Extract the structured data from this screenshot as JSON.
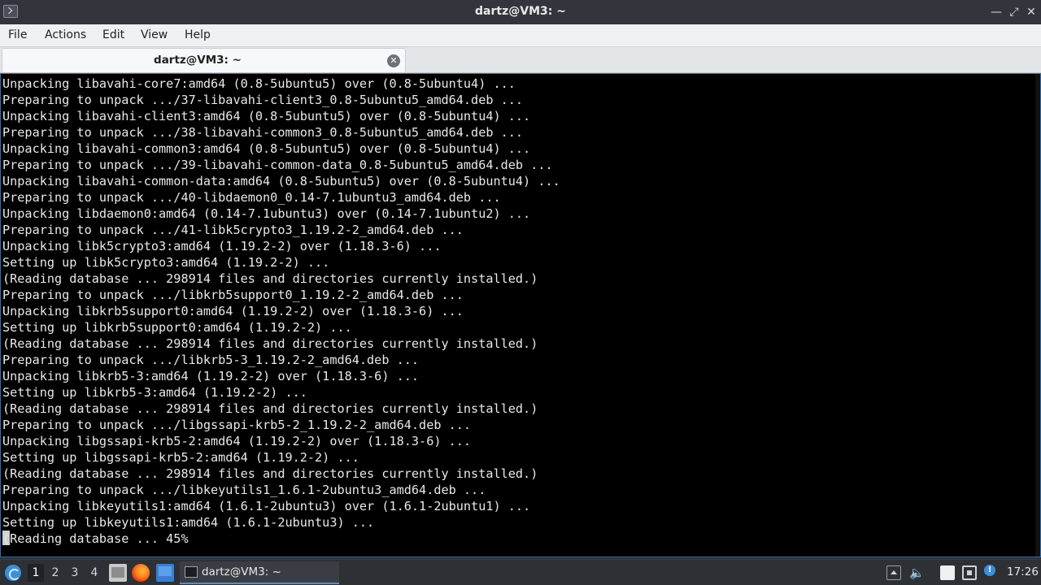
{
  "window": {
    "title": "dartz@VM3: ~",
    "icons": {
      "app": "terminal-icon",
      "minimize": "minimize-icon",
      "maximize": "maximize-icon",
      "close": "close-icon"
    }
  },
  "menu": {
    "file": "File",
    "actions": "Actions",
    "edit": "Edit",
    "view": "View",
    "help": "Help"
  },
  "tab": {
    "label": "dartz@VM3: ~",
    "close_icon": "close-circle-icon"
  },
  "terminal": {
    "lines": [
      "Unpacking libavahi-core7:amd64 (0.8-5ubuntu5) over (0.8-5ubuntu4) ...",
      "Preparing to unpack .../37-libavahi-client3_0.8-5ubuntu5_amd64.deb ...",
      "Unpacking libavahi-client3:amd64 (0.8-5ubuntu5) over (0.8-5ubuntu4) ...",
      "Preparing to unpack .../38-libavahi-common3_0.8-5ubuntu5_amd64.deb ...",
      "Unpacking libavahi-common3:amd64 (0.8-5ubuntu5) over (0.8-5ubuntu4) ...",
      "Preparing to unpack .../39-libavahi-common-data_0.8-5ubuntu5_amd64.deb ...",
      "Unpacking libavahi-common-data:amd64 (0.8-5ubuntu5) over (0.8-5ubuntu4) ...",
      "Preparing to unpack .../40-libdaemon0_0.14-7.1ubuntu3_amd64.deb ...",
      "Unpacking libdaemon0:amd64 (0.14-7.1ubuntu3) over (0.14-7.1ubuntu2) ...",
      "Preparing to unpack .../41-libk5crypto3_1.19.2-2_amd64.deb ...",
      "Unpacking libk5crypto3:amd64 (1.19.2-2) over (1.18.3-6) ...",
      "Setting up libk5crypto3:amd64 (1.19.2-2) ...",
      "(Reading database ... 298914 files and directories currently installed.)",
      "Preparing to unpack .../libkrb5support0_1.19.2-2_amd64.deb ...",
      "Unpacking libkrb5support0:amd64 (1.19.2-2) over (1.18.3-6) ...",
      "Setting up libkrb5support0:amd64 (1.19.2-2) ...",
      "(Reading database ... 298914 files and directories currently installed.)",
      "Preparing to unpack .../libkrb5-3_1.19.2-2_amd64.deb ...",
      "Unpacking libkrb5-3:amd64 (1.19.2-2) over (1.18.3-6) ...",
      "Setting up libkrb5-3:amd64 (1.19.2-2) ...",
      "(Reading database ... 298914 files and directories currently installed.)",
      "Preparing to unpack .../libgssapi-krb5-2_1.19.2-2_amd64.deb ...",
      "Unpacking libgssapi-krb5-2:amd64 (1.19.2-2) over (1.18.3-6) ...",
      "Setting up libgssapi-krb5-2:amd64 (1.19.2-2) ...",
      "(Reading database ... 298914 files and directories currently installed.)",
      "Preparing to unpack .../libkeyutils1_1.6.1-2ubuntu3_amd64.deb ...",
      "Unpacking libkeyutils1:amd64 (1.6.1-2ubuntu3) over (1.6.1-2ubuntu1) ...",
      "Setting up libkeyutils1:amd64 (1.6.1-2ubuntu3) ...",
      "(Reading database ... 45%"
    ],
    "colors": {
      "background": "#000000",
      "foreground": "#e8e8e8",
      "border": "#2f6fb3"
    }
  },
  "taskbar": {
    "workspaces": [
      "1",
      "2",
      "3",
      "4"
    ],
    "active_workspace": "1",
    "quicklaunch": [
      "file-manager-icon",
      "firefox-icon",
      "show-desktop-icon"
    ],
    "task_label": "dartz@VM3: ~",
    "tray_icons": [
      "tray-up-arrow-icon",
      "volume-icon",
      "clipboard-icon",
      "network-icon",
      "updates-icon"
    ],
    "updates_badge": "!",
    "clock": "17:26"
  }
}
